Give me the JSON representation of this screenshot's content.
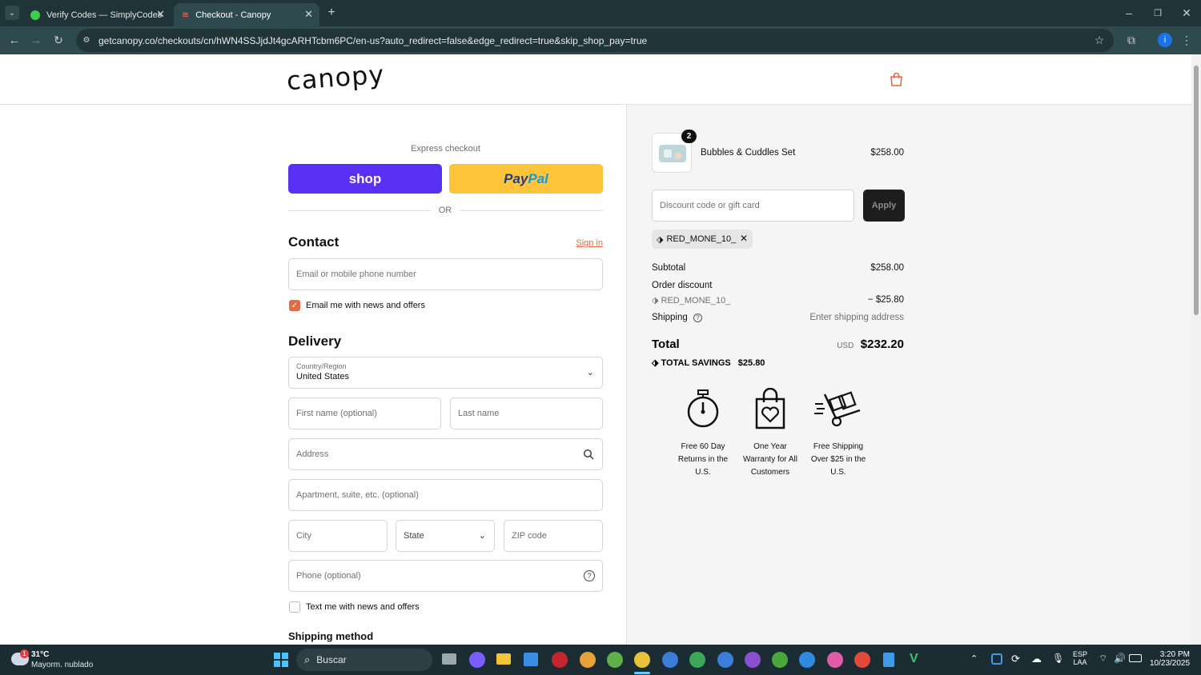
{
  "browser": {
    "tabs": [
      {
        "title": "Verify Codes — SimplyCodes",
        "active": false
      },
      {
        "title": "Checkout - Canopy",
        "active": true
      }
    ],
    "new_tab": "+",
    "url": "getcanopy.co/checkouts/cn/hWN4SSJjdJt4gcARHTcbm6PC/en-us?auto_redirect=false&edge_redirect=true&skip_shop_pay=true",
    "profile_initial": "i"
  },
  "store": {
    "logo": "canopy"
  },
  "express": {
    "label": "Express checkout",
    "shop_label": "shop",
    "paypal_pay": "Pay",
    "paypal_pal": "Pal",
    "or_label": "OR"
  },
  "contact": {
    "title": "Contact",
    "sign_in": "Sign in",
    "email_placeholder": "Email or mobile phone number",
    "email_news_label": "Email me with news and offers",
    "email_news_checked": true
  },
  "delivery": {
    "title": "Delivery",
    "country_label": "Country/Region",
    "country_value": "United States",
    "first_name": "First name (optional)",
    "last_name": "Last name",
    "address": "Address",
    "apartment": "Apartment, suite, etc. (optional)",
    "city": "City",
    "state": "State",
    "zip": "ZIP code",
    "phone": "Phone (optional)",
    "text_news_label": "Text me with news and offers",
    "text_news_checked": false,
    "shipping_method": "Shipping method"
  },
  "summary": {
    "item": {
      "name": "Bubbles & Cuddles Set",
      "qty": "2",
      "price": "$258.00"
    },
    "discount_placeholder": "Discount code or gift card",
    "apply": "Apply",
    "applied_code": "RED_MONE_10_",
    "subtotal_label": "Subtotal",
    "subtotal_value": "$258.00",
    "order_discount_label": "Order discount",
    "order_discount_code": "RED_MONE_10_",
    "order_discount_value": "− $25.80",
    "shipping_label": "Shipping",
    "shipping_value": "Enter shipping address",
    "total_label": "Total",
    "currency": "USD",
    "total_value": "$232.20",
    "savings_label": "TOTAL SAVINGS",
    "savings_value": "$25.80",
    "perks": [
      {
        "icon": "stopwatch-icon",
        "line1": "Free 60 Day",
        "line2": "Returns in the",
        "line3": "U.S."
      },
      {
        "icon": "shopping-bag-heart-icon",
        "line1": "One Year",
        "line2": "Warranty for All",
        "line3": "Customers"
      },
      {
        "icon": "hand-truck-icon",
        "line1": "Free Shipping",
        "line2": "Over $25 in the",
        "line3": "U.S."
      }
    ]
  },
  "taskbar": {
    "weather_temp": "31°C",
    "weather_desc": "Mayorm. nublado",
    "weather_badge": "1",
    "search": "Buscar",
    "lang1": "ESP",
    "lang2": "LAA",
    "time": "3:20 PM",
    "date": "10/23/2025"
  },
  "colors": {
    "shop": "#5a31f4",
    "paypal": "#ffc439",
    "accent": "#e06a4a",
    "apply_bg": "#1d1d1d",
    "chrome_tabbar": "#1f3338"
  }
}
